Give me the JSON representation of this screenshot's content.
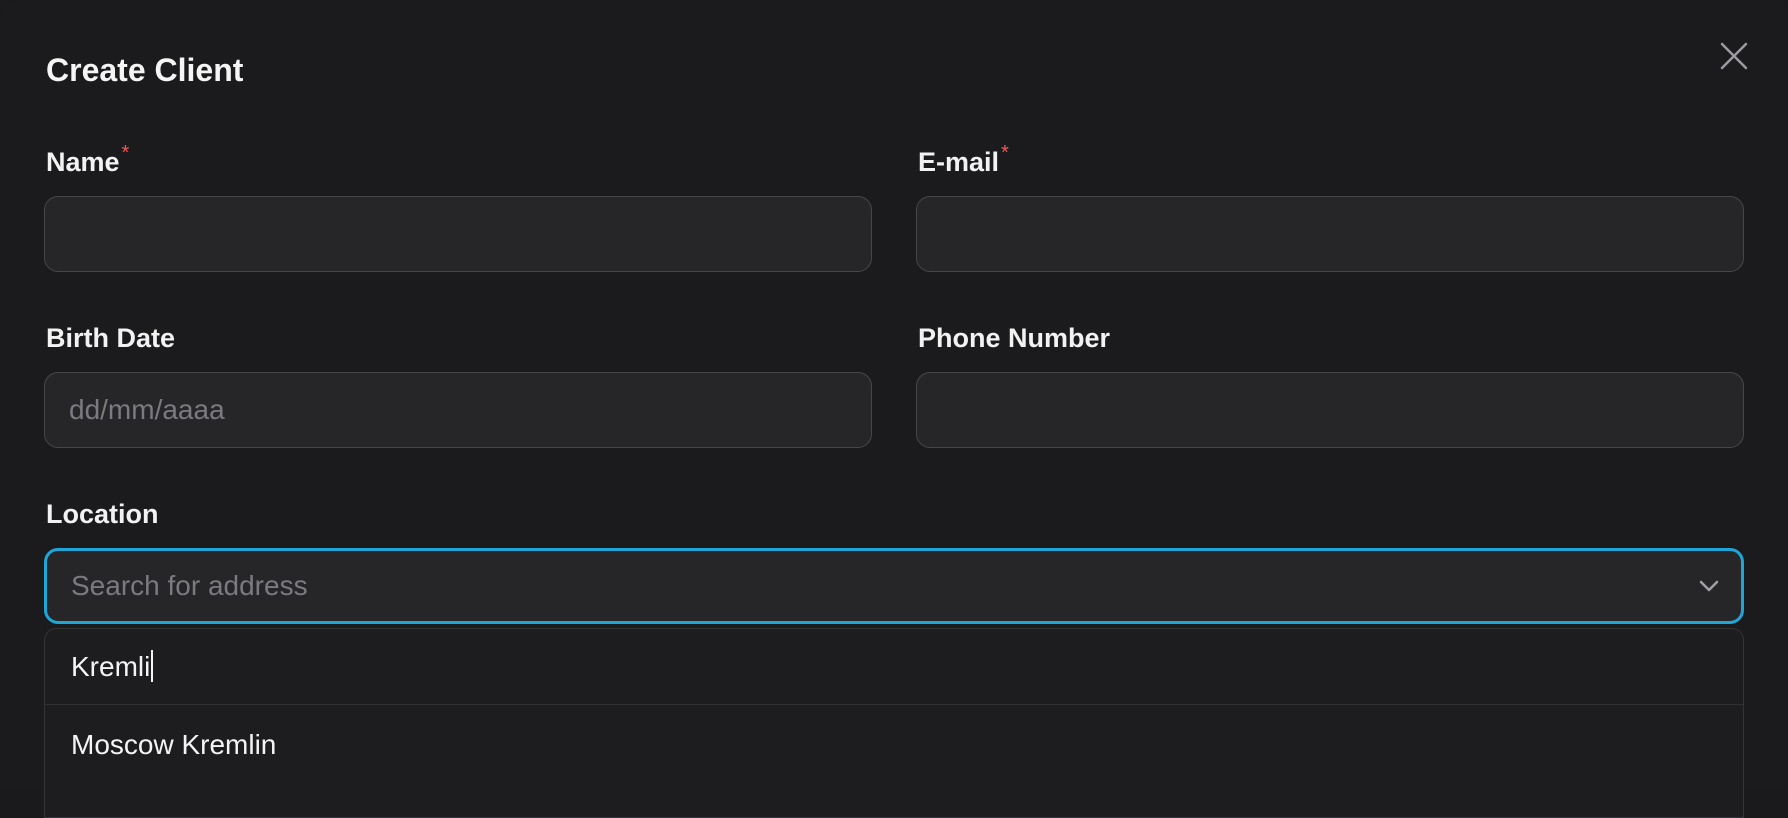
{
  "dialog": {
    "title": "Create Client"
  },
  "fields": {
    "name": {
      "label": "Name",
      "required_mark": "*",
      "value": ""
    },
    "email": {
      "label": "E-mail",
      "required_mark": "*",
      "value": ""
    },
    "birth_date": {
      "label": "Birth Date",
      "placeholder": "dd/mm/aaaa",
      "value": ""
    },
    "phone": {
      "label": "Phone Number",
      "value": ""
    },
    "location": {
      "label": "Location",
      "placeholder": "Search for address",
      "search_query": "Kremli",
      "options": [
        "Moscow Kremlin"
      ]
    }
  },
  "icons": {
    "close": "close-icon",
    "dropdown": "chevron-down-icon"
  },
  "colors": {
    "background": "#1b1b1e",
    "input_background": "#262629",
    "focus_border": "#1ea6d9",
    "required": "#ef5a5a",
    "text": "#f4f4f5",
    "placeholder": "#7a7a80"
  }
}
